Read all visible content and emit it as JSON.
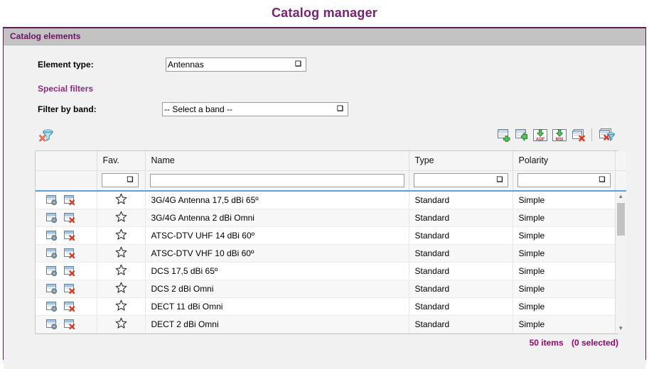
{
  "page": {
    "title": "Catalog manager",
    "accent_purple": "#6b1464",
    "accent_magenta": "#a3006b",
    "header_bg": "#c3c3c3"
  },
  "panel": {
    "header": "Catalog elements"
  },
  "form": {
    "element_type_label": "Element type:",
    "element_type_value": "Antennas",
    "special_filters_label": "Special filters",
    "filter_by_band_label": "Filter by band:",
    "filter_by_band_value": "-- Select a band --"
  },
  "toolbar": {
    "left": [
      {
        "name": "clear-filter-icon",
        "title": "Clear filter"
      }
    ],
    "right": [
      {
        "name": "new-element-icon",
        "title": "New element"
      },
      {
        "name": "import-element-icon",
        "title": "Import element"
      },
      {
        "name": "export-adf-icon",
        "title": "Export ADF",
        "tag": "ADF"
      },
      {
        "name": "export-msi-icon",
        "title": "Export MSI",
        "tag": "MSI"
      },
      {
        "name": "delete-selected-icon",
        "title": "Delete selected"
      },
      {
        "name": "delete-filtered-icon",
        "title": "Delete filtered"
      }
    ]
  },
  "grid": {
    "columns": [
      {
        "key": "actions",
        "label": ""
      },
      {
        "key": "fav",
        "label": "Fav."
      },
      {
        "key": "name",
        "label": "Name"
      },
      {
        "key": "type",
        "label": "Type"
      },
      {
        "key": "polarity",
        "label": "Polarity"
      }
    ],
    "filters": {
      "fav": "",
      "name": "",
      "name_placeholder": "",
      "type": "",
      "polarity": ""
    },
    "rows": [
      {
        "name": "3G/4G Antenna 17,5 dBi 65º",
        "type": "Standard",
        "polarity": "Simple",
        "favorite": false
      },
      {
        "name": "3G/4G Antenna 2 dBi Omni",
        "type": "Standard",
        "polarity": "Simple",
        "favorite": false
      },
      {
        "name": "ATSC-DTV UHF 14 dBi 60º",
        "type": "Standard",
        "polarity": "Simple",
        "favorite": false
      },
      {
        "name": "ATSC-DTV VHF 10 dBi 60º",
        "type": "Standard",
        "polarity": "Simple",
        "favorite": false
      },
      {
        "name": "DCS 17,5 dBi 65º",
        "type": "Standard",
        "polarity": "Simple",
        "favorite": false
      },
      {
        "name": "DCS 2 dBi Omni",
        "type": "Standard",
        "polarity": "Simple",
        "favorite": false
      },
      {
        "name": "DECT 11 dBi Omni",
        "type": "Standard",
        "polarity": "Simple",
        "favorite": false
      },
      {
        "name": "DECT 2 dBi Omni",
        "type": "Standard",
        "polarity": "Simple",
        "favorite": false
      }
    ],
    "row_actions": [
      {
        "name": "edit-element-icon",
        "title": "Edit element"
      },
      {
        "name": "delete-element-icon",
        "title": "Delete element"
      }
    ],
    "scrollbar": {
      "up": "▲",
      "down": "▼"
    }
  },
  "footer": {
    "items_count": "50 items",
    "selected_count": "(0 selected)"
  }
}
